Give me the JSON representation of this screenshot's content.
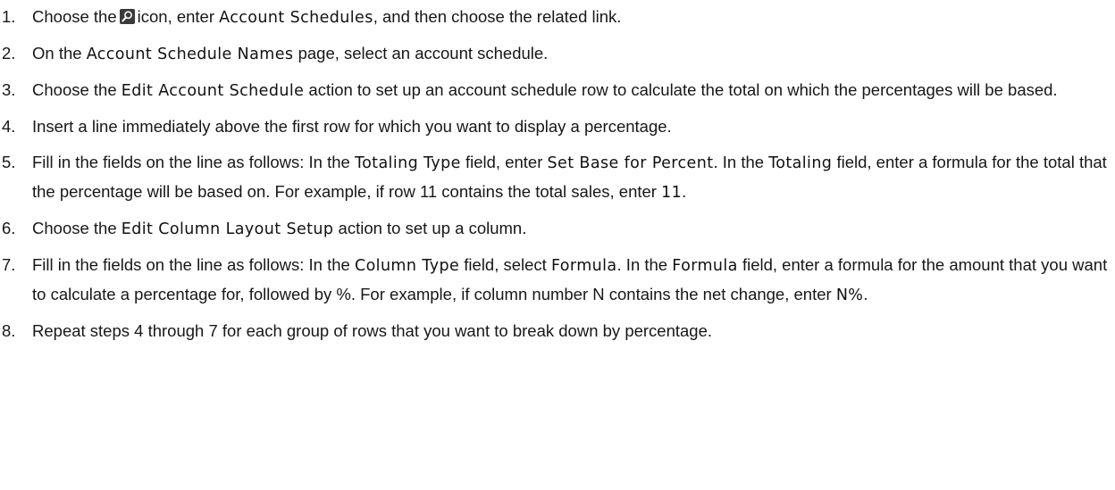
{
  "steps": [
    {
      "num": "1.",
      "parts": [
        {
          "t": "Choose the"
        },
        {
          "icon": "search-icon"
        },
        {
          "t": "icon, enter "
        },
        {
          "b": "Account Schedules"
        },
        {
          "t": ", and then choose the related link."
        }
      ]
    },
    {
      "num": "2.",
      "parts": [
        {
          "t": "On the "
        },
        {
          "b": "Account Schedule Names"
        },
        {
          "t": " page, select an account schedule."
        }
      ]
    },
    {
      "num": "3.",
      "parts": [
        {
          "t": "Choose the "
        },
        {
          "b": "Edit Account Schedule"
        },
        {
          "t": " action to set up an account schedule row to calculate the total on which the percentages will be based."
        }
      ]
    },
    {
      "num": "4.",
      "parts": [
        {
          "t": "Insert a line immediately above the first row for which you want to display a percentage."
        }
      ]
    },
    {
      "num": "5.",
      "parts": [
        {
          "t": "Fill in the fields on the line as follows: In the "
        },
        {
          "b": "Totaling Type"
        },
        {
          "t": " field, enter "
        },
        {
          "b": "Set Base for Percent"
        },
        {
          "t": ". In the "
        },
        {
          "b": "Totaling"
        },
        {
          "t": " field, enter a formula for the total that the percentage will be based on. For example, if row 11 contains the total sales, enter "
        },
        {
          "b": "11"
        },
        {
          "t": "."
        }
      ]
    },
    {
      "num": "6.",
      "parts": [
        {
          "t": "Choose the "
        },
        {
          "b": "Edit Column Layout Setup"
        },
        {
          "t": " action to set up a column."
        }
      ]
    },
    {
      "num": "7.",
      "parts": [
        {
          "t": "Fill in the fields on the line as follows: In the "
        },
        {
          "b": "Column Type"
        },
        {
          "t": " field, select "
        },
        {
          "b": "Formula"
        },
        {
          "t": ". In the "
        },
        {
          "b": "Formula"
        },
        {
          "t": " field, enter a formula for the amount that you want to calculate a percentage for, followed by %. For example, if column number N contains the net change, enter "
        },
        {
          "b": "N%"
        },
        {
          "t": "."
        }
      ]
    },
    {
      "num": "8.",
      "parts": [
        {
          "t": "Repeat steps 4 through 7 for each group of rows that you want to break down by percentage."
        }
      ]
    }
  ]
}
